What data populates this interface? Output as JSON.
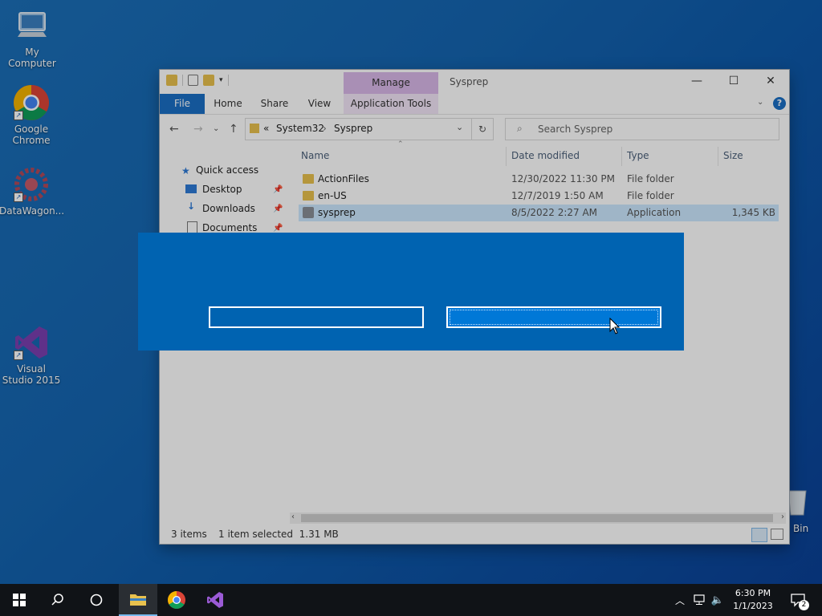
{
  "desktop": {
    "icons": [
      {
        "label": "My Computer",
        "icon": "computer-icon"
      },
      {
        "label": "Google Chrome",
        "icon": "chrome-icon"
      },
      {
        "label": "DataWagon...",
        "icon": "datawagon-icon"
      },
      {
        "label": "Visual Studio 2015",
        "icon": "visual-studio-icon"
      }
    ],
    "recycle_bin_label": "Bin"
  },
  "window": {
    "title": "Sysprep",
    "manage_tab": "Manage",
    "ribbon_tabs": [
      "File",
      "Home",
      "Share",
      "View",
      "Application Tools"
    ],
    "address": {
      "prefix": "«",
      "crumbs": [
        "System32",
        "Sysprep"
      ]
    },
    "search_placeholder": "Search Sysprep",
    "nav": {
      "quick_access": "Quick access",
      "items": [
        "Desktop",
        "Downloads",
        "Documents"
      ]
    },
    "columns": [
      "Name",
      "Date modified",
      "Type",
      "Size"
    ],
    "files": [
      {
        "name": "ActionFiles",
        "date": "12/30/2022 11:30 PM",
        "type": "File folder",
        "size": "",
        "kind": "folder",
        "selected": false
      },
      {
        "name": "en-US",
        "date": "12/7/2019 1:50 AM",
        "type": "File folder",
        "size": "",
        "kind": "folder",
        "selected": false
      },
      {
        "name": "sysprep",
        "date": "8/5/2022 2:27 AM",
        "type": "Application",
        "size": "1,345 KB",
        "kind": "app",
        "selected": true
      }
    ],
    "status": {
      "items": "3 items",
      "selection": "1 item selected  1.31 MB"
    }
  },
  "dialog": {
    "button_left_label": "",
    "button_right_label": ""
  },
  "taskbar": {
    "time": "6:30 PM",
    "date": "1/1/2023",
    "notification_count": "2"
  },
  "colors": {
    "dialog_bg": "#0063b1",
    "accent": "#0078d7",
    "file_tab": "#1a6fc4",
    "manage_tab": "#d9b8e8",
    "taskbar": "#101317"
  }
}
